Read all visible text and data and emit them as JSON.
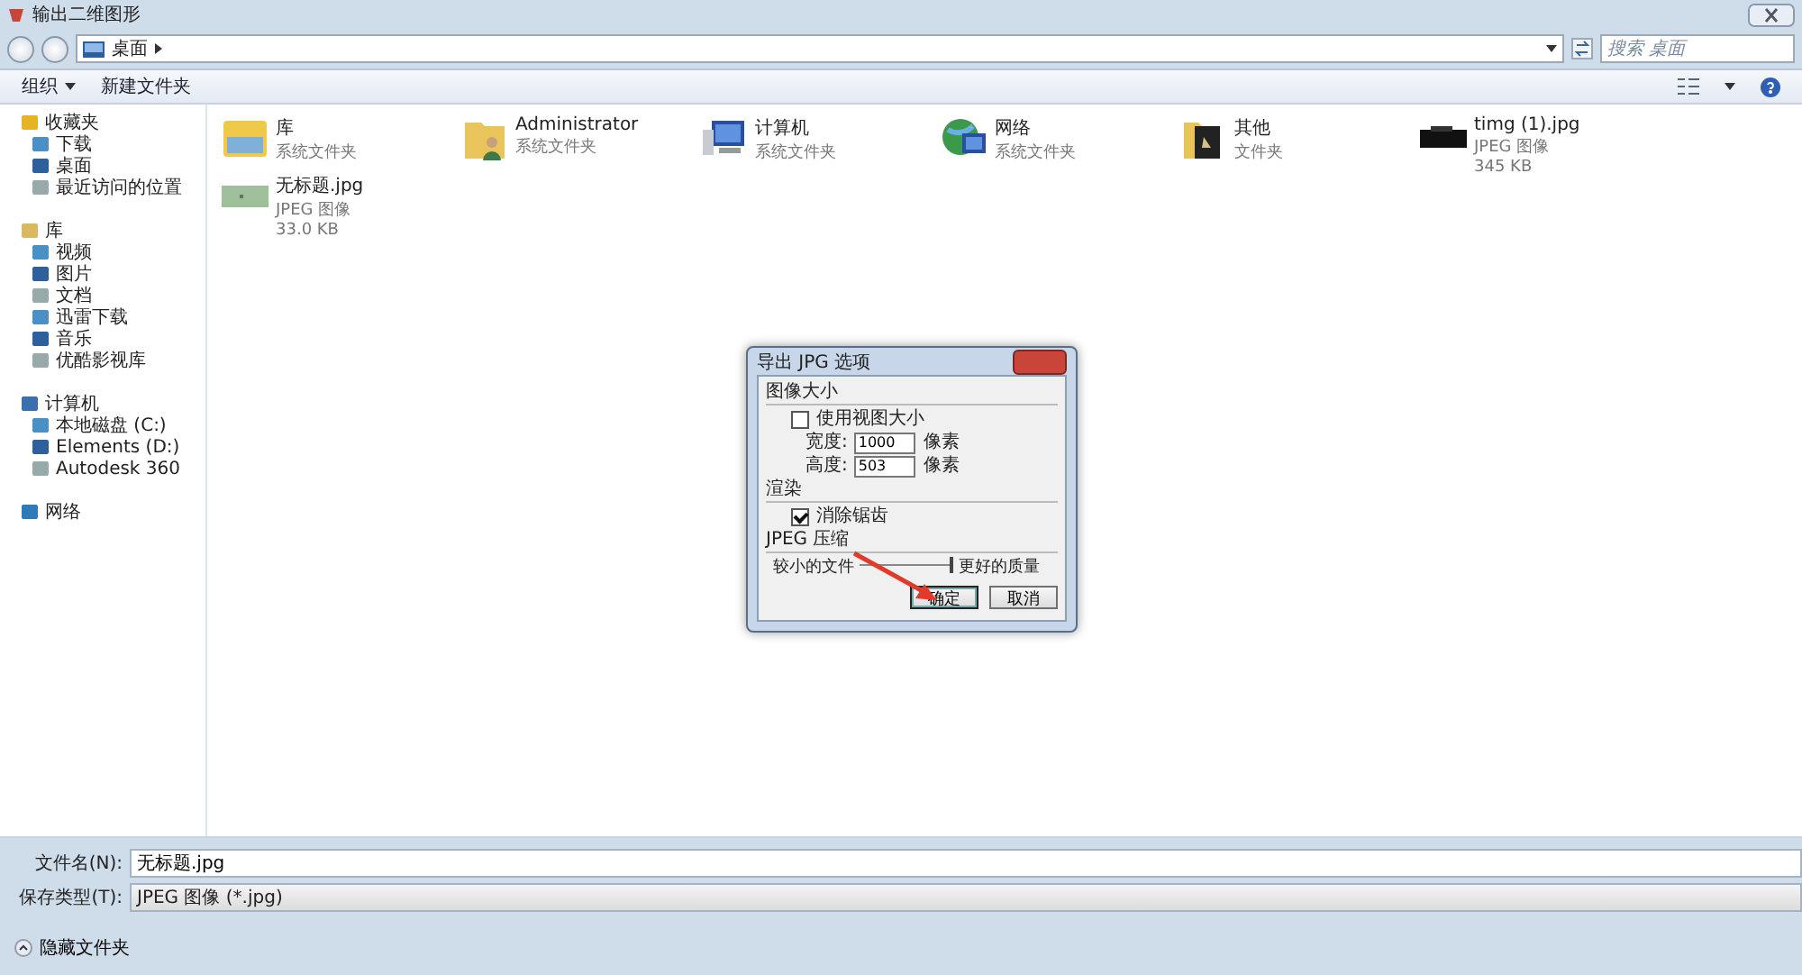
{
  "window": {
    "title": "输出二维图形"
  },
  "address": {
    "breadcrumb": "桌面",
    "search_placeholder": "搜索 桌面"
  },
  "toolbar": {
    "organize": "组织",
    "new_folder": "新建文件夹"
  },
  "sidebar": {
    "groups": [
      {
        "label": "收藏夹",
        "children": [
          {
            "label": "下载"
          },
          {
            "label": "桌面"
          },
          {
            "label": "最近访问的位置"
          }
        ]
      },
      {
        "label": "库",
        "children": [
          {
            "label": "视频"
          },
          {
            "label": "图片"
          },
          {
            "label": "文档"
          },
          {
            "label": "迅雷下载"
          },
          {
            "label": "音乐"
          },
          {
            "label": "优酷影视库"
          }
        ]
      },
      {
        "label": "计算机",
        "children": [
          {
            "label": "本地磁盘 (C:)"
          },
          {
            "label": "Elements (D:)"
          },
          {
            "label": "Autodesk 360"
          }
        ]
      },
      {
        "label": "网络"
      }
    ]
  },
  "files": [
    {
      "kind": "library",
      "name": "库",
      "type": "系统文件夹"
    },
    {
      "kind": "user",
      "name": "Administrator",
      "type": "系统文件夹"
    },
    {
      "kind": "computer",
      "name": "计算机",
      "type": "系统文件夹"
    },
    {
      "kind": "network",
      "name": "网络",
      "type": "系统文件夹"
    },
    {
      "kind": "folder",
      "name": "其他",
      "type": "文件夹"
    },
    {
      "kind": "dark-image",
      "name": "timg (1).jpg",
      "type": "JPEG 图像",
      "size": "345 KB"
    },
    {
      "kind": "image",
      "name": "无标题.jpg",
      "type": "JPEG 图像",
      "size": "33.0 KB"
    }
  ],
  "dialog": {
    "title": "导出 JPG 选项",
    "size_section": "图像大小",
    "use_view_size": {
      "label": "使用视图大小",
      "checked": false
    },
    "width": {
      "label": "宽度:",
      "value": "1000",
      "unit": "像素"
    },
    "height": {
      "label": "高度:",
      "value": "503",
      "unit": "像素"
    },
    "render_section": "渲染",
    "antialias": {
      "label": "消除锯齿",
      "checked": true
    },
    "compression_section": "JPEG 压缩",
    "quality": {
      "left": "较小的文件",
      "right": "更好的质量",
      "level": 1
    },
    "buttons": [
      {
        "label": "确定",
        "default": true
      },
      {
        "label": "取消",
        "default": false
      }
    ]
  },
  "bottom": {
    "filename_label": "文件名(N):",
    "filename": "无标题.jpg",
    "type_label": "保存类型(T):",
    "type": "JPEG 图像 (*.jpg)",
    "hide_folders": "隐藏文件夹"
  }
}
